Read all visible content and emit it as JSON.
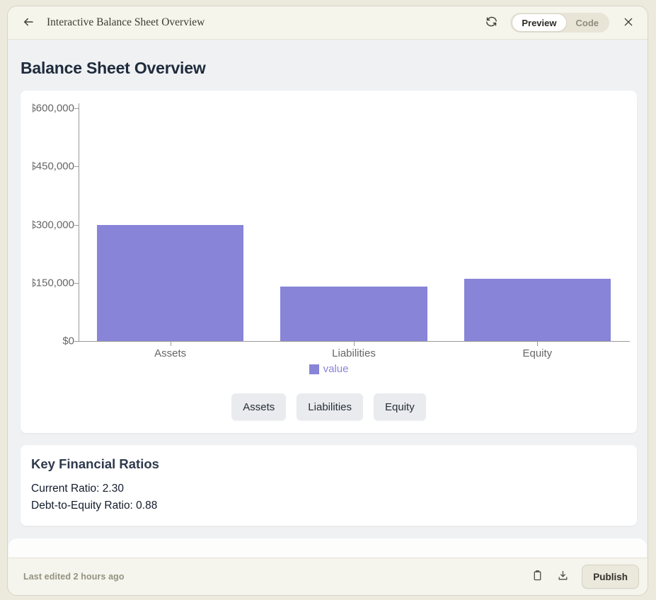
{
  "header": {
    "title": "Interactive Balance Sheet Overview",
    "view_toggle": {
      "preview_label": "Preview",
      "code_label": "Code",
      "selected": "Preview"
    }
  },
  "main": {
    "page_title": "Balance Sheet Overview",
    "filter_buttons": [
      "Assets",
      "Liabilities",
      "Equity"
    ],
    "ratios_card": {
      "title": "Key Financial Ratios",
      "current_ratio_line": "Current Ratio: 2.30",
      "debt_to_equity_line": "Debt-to-Equity Ratio: 0.88"
    }
  },
  "footer": {
    "last_edited": "Last edited 2 hours ago",
    "publish_label": "Publish"
  },
  "chart_data": {
    "type": "bar",
    "title": "",
    "xlabel": "",
    "ylabel": "",
    "categories": [
      "Assets",
      "Liabilities",
      "Equity"
    ],
    "series": [
      {
        "name": "value",
        "values": [
          300000,
          140000,
          160000
        ]
      }
    ],
    "ylim": [
      0,
      600000
    ],
    "y_ticks": [
      {
        "label": "$0",
        "value": 0
      },
      {
        "label": "$150,000",
        "value": 150000
      },
      {
        "label": "$300,000",
        "value": 300000
      },
      {
        "label": "$450,000",
        "value": 450000
      },
      {
        "label": "$600,000",
        "value": 600000
      }
    ],
    "grid": false,
    "legend_position": "bottom",
    "legend": [
      {
        "label": "value",
        "color": "#8884d8"
      }
    ],
    "bar_color": "#8884d8",
    "axis_color": "#999999",
    "tick_label_color": "#666666"
  },
  "colors": {
    "outer_background": "#ece9dd",
    "header_background": "#f6f5ec",
    "content_background": "#eff1f3",
    "card_background": "#ffffff",
    "accent_bar": "#8884d8",
    "footer_background": "#f5f4ed"
  }
}
